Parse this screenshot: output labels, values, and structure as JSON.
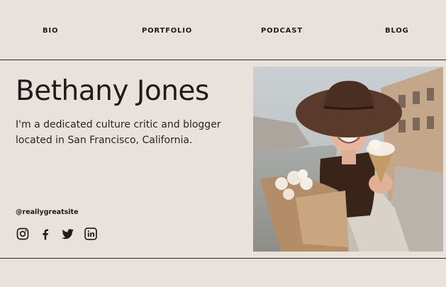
{
  "nav": {
    "items": [
      {
        "label": "BIO"
      },
      {
        "label": "PORTFOLIO"
      },
      {
        "label": "PODCAST"
      },
      {
        "label": "BLOG"
      }
    ]
  },
  "profile": {
    "name": "Bethany Jones",
    "bio": "I'm a dedicated culture critic and blogger located in San Francisco, California.",
    "handle": "@reallygreatsite"
  },
  "socials": [
    {
      "icon": "instagram-icon"
    },
    {
      "icon": "facebook-icon"
    },
    {
      "icon": "twitter-icon"
    },
    {
      "icon": "linkedin-icon"
    }
  ],
  "photo": {
    "subject": "woman-with-hat-ice-cream-and-flowers"
  },
  "colors": {
    "background": "#e9e2dc",
    "text": "#1f1b1a"
  }
}
